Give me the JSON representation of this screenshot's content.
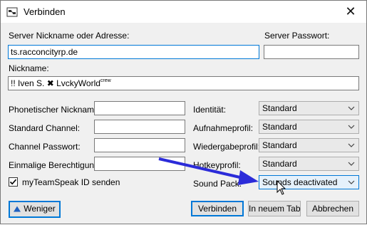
{
  "window": {
    "title": "Verbinden",
    "close_glyph": "✕",
    "app_icon": "teamspeak-connect-icon"
  },
  "server": {
    "address_label": "Server Nickname oder Adresse:",
    "address_value": "ts.racconcityrp.de",
    "password_label": "Server Passwort:",
    "password_value": ""
  },
  "nickname": {
    "label": "Nickname:",
    "value_prefix": "!! Iven S.",
    "value_symbol": "✖",
    "value_name": "LvckyWorld",
    "value_suffix": "crew"
  },
  "fields": {
    "phonetic_label": "Phonetischer Nickname:",
    "phonetic_value": "",
    "channel_label": "Standard Channel:",
    "channel_value": "",
    "channel_password_label": "Channel Passwort:",
    "channel_password_value": "",
    "privilege_label": "Einmalige Berechtigung:",
    "privilege_value": ""
  },
  "profiles": {
    "identity_label": "Identität:",
    "identity_value": "Standard",
    "capture_label": "Aufnahmeprofil:",
    "capture_value": "Standard",
    "playback_label": "Wiedergabeprofil:",
    "playback_value": "Standard",
    "hotkey_label": "Hotkeyprofil:",
    "hotkey_value": "Standard",
    "soundpack_label": "Sound Pack:",
    "soundpack_value": "Sounds deactivated"
  },
  "checkbox": {
    "label": "myTeamSpeak ID senden",
    "checked": true
  },
  "buttons": {
    "less": "Weniger",
    "connect": "Verbinden",
    "new_tab": "In neuem Tab",
    "cancel": "Abbrechen"
  },
  "colors": {
    "accent": "#0078d7",
    "annotation_arrow": "#2b2bd9"
  }
}
